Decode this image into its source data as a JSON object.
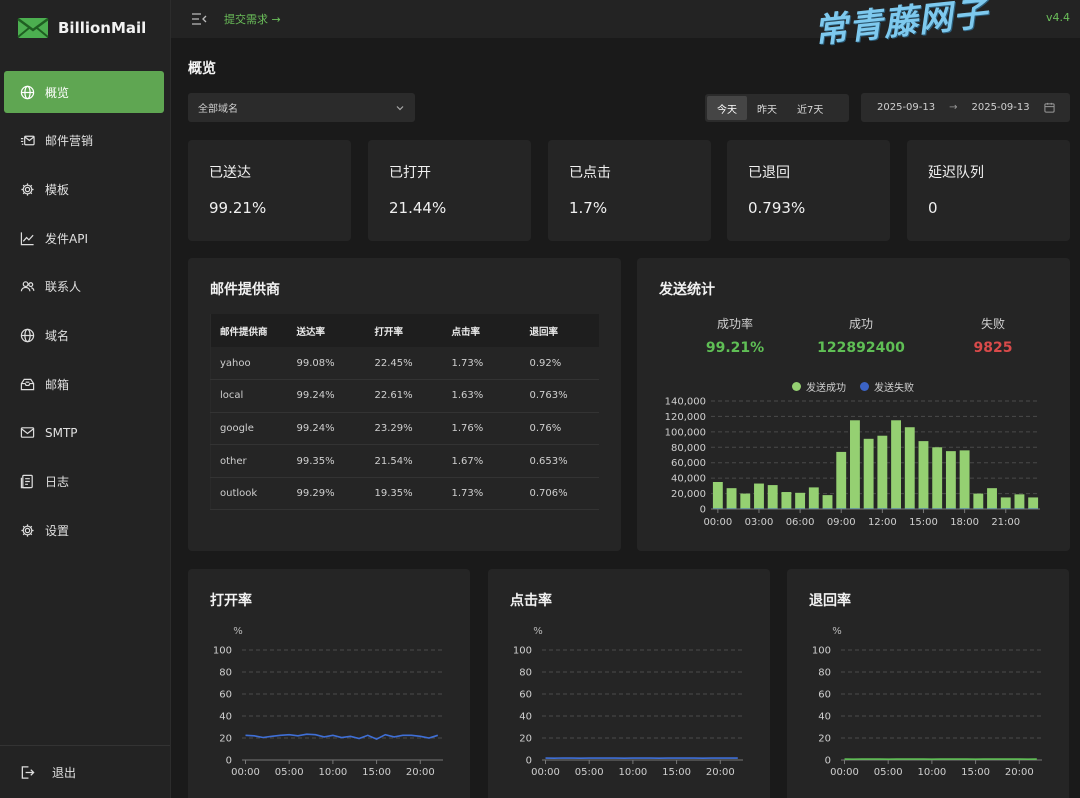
{
  "app": {
    "name": "BillionMail",
    "submit_link": "提交需求 →",
    "version": "v4.4",
    "watermark": "常青藤网子"
  },
  "sidebar": {
    "items": [
      {
        "label": "概览",
        "icon": "globe-icon",
        "active": true
      },
      {
        "label": "邮件营销",
        "icon": "mail-campaign-icon",
        "active": false
      },
      {
        "label": "模板",
        "icon": "gear-icon",
        "active": false
      },
      {
        "label": "发件API",
        "icon": "line-chart-icon",
        "active": false
      },
      {
        "label": "联系人",
        "icon": "users-icon",
        "active": false
      },
      {
        "label": "域名",
        "icon": "globe-icon",
        "active": false
      },
      {
        "label": "邮箱",
        "icon": "mailbox-icon",
        "active": false
      },
      {
        "label": "SMTP",
        "icon": "envelope-icon",
        "active": false
      },
      {
        "label": "日志",
        "icon": "log-icon",
        "active": false
      },
      {
        "label": "设置",
        "icon": "gear-icon",
        "active": false
      }
    ],
    "logout": "退出"
  },
  "page": {
    "title": "概览",
    "domain_select": "全部域名",
    "ranges": [
      "今天",
      "昨天",
      "近7天"
    ],
    "active_range": 0,
    "date_start": "2025-09-13",
    "date_end": "2025-09-13",
    "date_arrow": "→"
  },
  "stats": [
    {
      "label": "已送达",
      "value": "99.21%"
    },
    {
      "label": "已打开",
      "value": "21.44%"
    },
    {
      "label": "已点击",
      "value": "1.7%"
    },
    {
      "label": "已退回",
      "value": "0.793%"
    },
    {
      "label": "延迟队列",
      "value": "0"
    }
  ],
  "providers": {
    "title": "邮件提供商",
    "columns": [
      "邮件提供商",
      "送达率",
      "打开率",
      "点击率",
      "退回率"
    ],
    "rows": [
      [
        "yahoo",
        "99.08%",
        "22.45%",
        "1.73%",
        "0.92%"
      ],
      [
        "local",
        "99.24%",
        "22.61%",
        "1.63%",
        "0.763%"
      ],
      [
        "google",
        "99.24%",
        "23.29%",
        "1.76%",
        "0.76%"
      ],
      [
        "other",
        "99.35%",
        "21.54%",
        "1.67%",
        "0.653%"
      ],
      [
        "outlook",
        "99.29%",
        "19.35%",
        "1.73%",
        "0.706%"
      ]
    ]
  },
  "send_stats": {
    "title": "发送统计",
    "kpis": [
      {
        "label": "成功率",
        "value": "99.21%",
        "color": "#5fbf55"
      },
      {
        "label": "成功",
        "value": "122892400",
        "color": "#5fbf55"
      },
      {
        "label": "失败",
        "value": "9825",
        "color": "#d94a4a"
      }
    ],
    "legend": [
      {
        "label": "发送成功",
        "color": "#95d072"
      },
      {
        "label": "发送失败",
        "color": "#3b63c4"
      }
    ]
  },
  "line_panels": [
    {
      "title": "打开率"
    },
    {
      "title": "点击率"
    },
    {
      "title": "退回率"
    }
  ],
  "chart_data": [
    {
      "type": "bar",
      "title": "发送统计",
      "x_ticks": [
        "00:00",
        "03:00",
        "06:00",
        "09:00",
        "12:00",
        "15:00",
        "18:00",
        "21:00"
      ],
      "y_ticks": [
        "0",
        "20,000",
        "40,000",
        "60,000",
        "80,000",
        "100,000",
        "120,000",
        "140,000"
      ],
      "ylim": [
        0,
        140000
      ],
      "grid": true,
      "legend_position": "top",
      "series": [
        {
          "name": "发送成功",
          "color": "#95d072",
          "values": [
            35000,
            27000,
            20000,
            33000,
            31000,
            22000,
            21000,
            28000,
            18000,
            74000,
            115000,
            91000,
            95000,
            115000,
            106000,
            88000,
            80000,
            75000,
            76000,
            20000,
            27000,
            15000,
            19000,
            15000
          ]
        },
        {
          "name": "发送失败",
          "color": "#3b63c4",
          "values": [
            3,
            2,
            2,
            3,
            3,
            2,
            2,
            2,
            2,
            6,
            9,
            7,
            8,
            9,
            8,
            7,
            6,
            6,
            6,
            2,
            2,
            1,
            2,
            1
          ]
        }
      ]
    },
    {
      "type": "line",
      "title": "打开率",
      "ylabel": "%",
      "ylim": [
        0,
        100
      ],
      "y_ticks": [
        "0",
        "20",
        "40",
        "60",
        "80",
        "100"
      ],
      "x_ticks": [
        "00:00",
        "05:00",
        "10:00",
        "15:00",
        "20:00"
      ],
      "series": [
        {
          "color": "#3f6fd6",
          "values": [
            22.5,
            22,
            20.5,
            21.5,
            22.5,
            23,
            22,
            23.5,
            23,
            21,
            22.5,
            20.5,
            21.5,
            19.5,
            22.5,
            19,
            23,
            21,
            22.5,
            22.5,
            21.5,
            20,
            22.5
          ]
        }
      ]
    },
    {
      "type": "line",
      "title": "点击率",
      "ylabel": "%",
      "ylim": [
        0,
        100
      ],
      "y_ticks": [
        "0",
        "20",
        "40",
        "60",
        "80",
        "100"
      ],
      "x_ticks": [
        "00:00",
        "05:00",
        "10:00",
        "15:00",
        "20:00"
      ],
      "series": [
        {
          "color": "#3f6fd6",
          "values": [
            1.7,
            1.6,
            1.8,
            1.7,
            1.6,
            1.7,
            1.8,
            1.7,
            1.7,
            1.6,
            1.7,
            1.8,
            1.7,
            1.6,
            1.7,
            1.8,
            1.7,
            1.7,
            1.6,
            1.7,
            1.8,
            1.7,
            1.7
          ]
        }
      ]
    },
    {
      "type": "line",
      "title": "退回率",
      "ylabel": "%",
      "ylim": [
        0,
        100
      ],
      "y_ticks": [
        "0",
        "20",
        "40",
        "60",
        "80",
        "100"
      ],
      "x_ticks": [
        "00:00",
        "05:00",
        "10:00",
        "15:00",
        "20:00"
      ],
      "series": [
        {
          "color": "#5fbf55",
          "values": [
            0.8,
            0.7,
            0.9,
            0.8,
            0.8,
            0.7,
            0.8,
            0.9,
            0.8,
            0.8,
            0.7,
            0.8,
            0.8,
            0.9,
            0.8,
            0.7,
            0.8,
            0.8,
            0.8,
            0.9,
            0.8,
            0.7,
            0.8
          ]
        }
      ]
    }
  ]
}
